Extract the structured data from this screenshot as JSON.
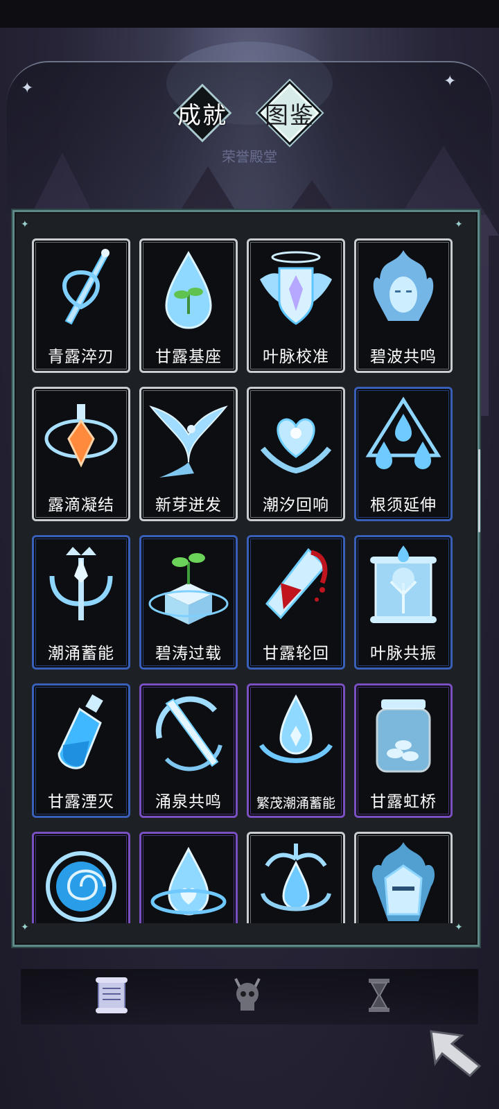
{
  "tabs": [
    {
      "label": "成就",
      "state": "inactive"
    },
    {
      "label": "图鉴",
      "state": "active"
    }
  ],
  "header_faded_title": "荣誉殿堂",
  "cards": [
    {
      "name": "青露淬刃",
      "frame": "white",
      "icon": "sword-heart-icon"
    },
    {
      "name": "甘露基座",
      "frame": "white",
      "icon": "drop-sprout-icon"
    },
    {
      "name": "叶脉校准",
      "frame": "white",
      "icon": "winged-crystal-shield-icon"
    },
    {
      "name": "碧波共鸣",
      "frame": "white",
      "icon": "water-spirit-face-icon"
    },
    {
      "name": "露滴凝结",
      "frame": "white",
      "icon": "potion-gem-icon"
    },
    {
      "name": "新芽迸发",
      "frame": "white",
      "icon": "phoenix-icon"
    },
    {
      "name": "潮汐回响",
      "frame": "white",
      "icon": "crystal-heart-hands-icon"
    },
    {
      "name": "根须延伸",
      "frame": "blue",
      "icon": "triple-drop-icon"
    },
    {
      "name": "潮涌蓄能",
      "frame": "blue",
      "icon": "trident-crown-icon"
    },
    {
      "name": "碧涛过载",
      "frame": "blue",
      "icon": "sprout-cube-icon"
    },
    {
      "name": "甘露轮回",
      "frame": "blue",
      "icon": "bleeding-crystal-icon"
    },
    {
      "name": "叶脉共振",
      "frame": "blue",
      "icon": "tree-scroll-icon"
    },
    {
      "name": "甘露湮灭",
      "frame": "blue",
      "icon": "potion-bottle-icon"
    },
    {
      "name": "涌泉共鸣",
      "frame": "purple",
      "icon": "crescent-dagger-icon"
    },
    {
      "name": "繁茂潮涌蓄能",
      "frame": "purple",
      "icon": "crystal-drop-splash-icon"
    },
    {
      "name": "甘露虹桥",
      "frame": "purple",
      "icon": "coin-jar-icon"
    },
    {
      "name": "",
      "frame": "purple",
      "icon": "vortex-icon"
    },
    {
      "name": "",
      "frame": "purple",
      "icon": "heart-drop-icon"
    },
    {
      "name": "",
      "frame": "white",
      "icon": "fountain-drop-icon"
    },
    {
      "name": "",
      "frame": "white",
      "icon": "flaming-helmet-icon"
    }
  ],
  "bottom_nav": [
    {
      "icon": "scroll-icon",
      "state": "active"
    },
    {
      "icon": "skull-icon",
      "state": "inactive"
    },
    {
      "icon": "hourglass-icon",
      "state": "inactive"
    }
  ],
  "back_button_icon": "back-arrow-icon",
  "colors": {
    "frame_white": "#c9cdd2",
    "frame_blue": "#3a5fb8",
    "frame_purple": "#7a4fc1",
    "icon_glow": "#7fd0ff",
    "panel_border": "#5d8a89"
  }
}
